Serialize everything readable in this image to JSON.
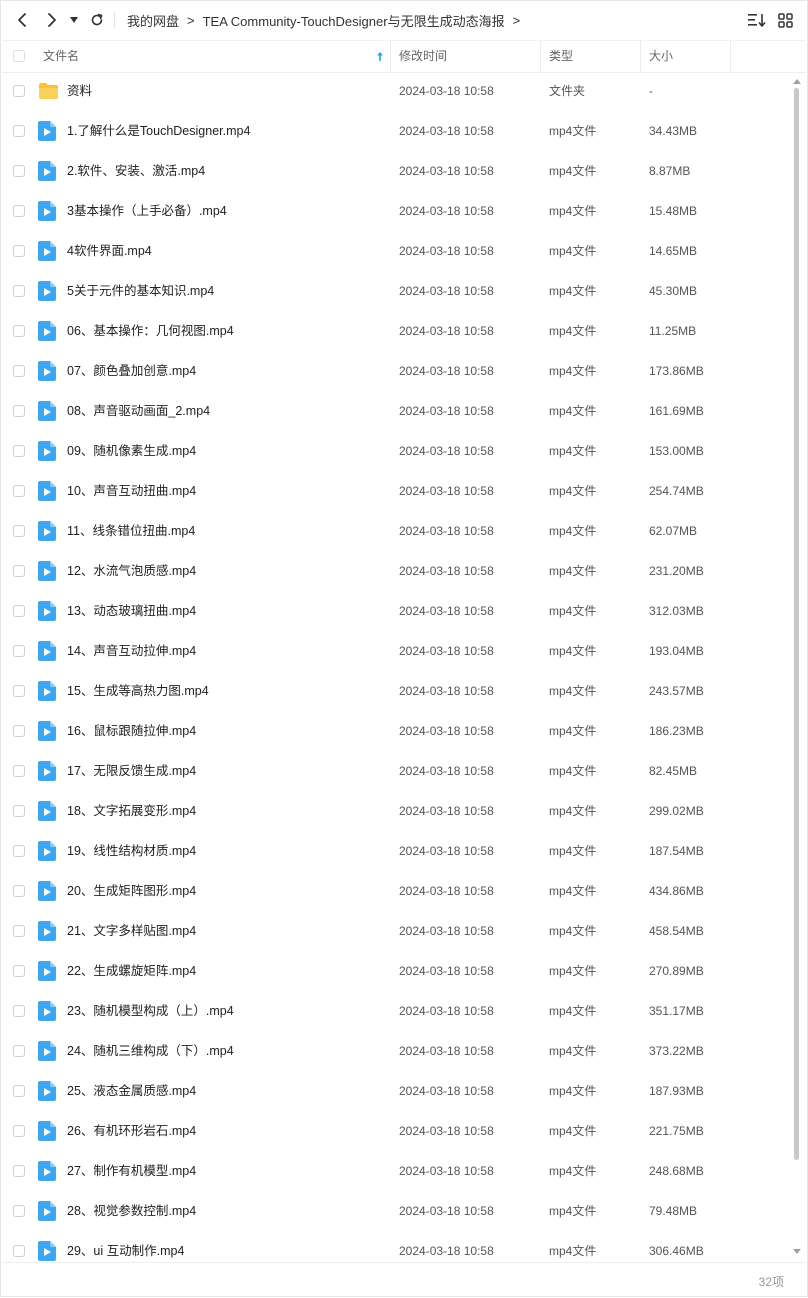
{
  "nav": {
    "breadcrumbs": [
      "我的网盘",
      "TEA Community-TouchDesigner与无限生成动态海报"
    ]
  },
  "columns": {
    "name": "文件名",
    "time": "修改时间",
    "type": "类型",
    "size": "大小"
  },
  "files": [
    {
      "name": "资料",
      "time": "2024-03-18 10:58",
      "type": "文件夹",
      "size": "-",
      "icon": "folder-icon"
    },
    {
      "name": "1.了解什么是TouchDesigner.mp4",
      "time": "2024-03-18 10:58",
      "type": "mp4文件",
      "size": "34.43MB",
      "icon": "video-file-icon"
    },
    {
      "name": "2.软件、安装、激活.mp4",
      "time": "2024-03-18 10:58",
      "type": "mp4文件",
      "size": "8.87MB",
      "icon": "video-file-icon"
    },
    {
      "name": "3基本操作（上手必备）.mp4",
      "time": "2024-03-18 10:58",
      "type": "mp4文件",
      "size": "15.48MB",
      "icon": "video-file-icon"
    },
    {
      "name": "4软件界面.mp4",
      "time": "2024-03-18 10:58",
      "type": "mp4文件",
      "size": "14.65MB",
      "icon": "video-file-icon"
    },
    {
      "name": "5关于元件的基本知识.mp4",
      "time": "2024-03-18 10:58",
      "type": "mp4文件",
      "size": "45.30MB",
      "icon": "video-file-icon"
    },
    {
      "name": "06、基本操作：几何视图.mp4",
      "time": "2024-03-18 10:58",
      "type": "mp4文件",
      "size": "11.25MB",
      "icon": "video-file-icon"
    },
    {
      "name": "07、颜色叠加创意.mp4",
      "time": "2024-03-18 10:58",
      "type": "mp4文件",
      "size": "173.86MB",
      "icon": "video-file-icon"
    },
    {
      "name": "08、声音驱动画面_2.mp4",
      "time": "2024-03-18 10:58",
      "type": "mp4文件",
      "size": "161.69MB",
      "icon": "video-file-icon"
    },
    {
      "name": "09、随机像素生成.mp4",
      "time": "2024-03-18 10:58",
      "type": "mp4文件",
      "size": "153.00MB",
      "icon": "video-file-icon"
    },
    {
      "name": "10、声音互动扭曲.mp4",
      "time": "2024-03-18 10:58",
      "type": "mp4文件",
      "size": "254.74MB",
      "icon": "video-file-icon"
    },
    {
      "name": "11、线条错位扭曲.mp4",
      "time": "2024-03-18 10:58",
      "type": "mp4文件",
      "size": "62.07MB",
      "icon": "video-file-icon"
    },
    {
      "name": "12、水流气泡质感.mp4",
      "time": "2024-03-18 10:58",
      "type": "mp4文件",
      "size": "231.20MB",
      "icon": "video-file-icon"
    },
    {
      "name": "13、动态玻璃扭曲.mp4",
      "time": "2024-03-18 10:58",
      "type": "mp4文件",
      "size": "312.03MB",
      "icon": "video-file-icon"
    },
    {
      "name": "14、声音互动拉伸.mp4",
      "time": "2024-03-18 10:58",
      "type": "mp4文件",
      "size": "193.04MB",
      "icon": "video-file-icon"
    },
    {
      "name": "15、生成等高热力图.mp4",
      "time": "2024-03-18 10:58",
      "type": "mp4文件",
      "size": "243.57MB",
      "icon": "video-file-icon"
    },
    {
      "name": "16、鼠标跟随拉伸.mp4",
      "time": "2024-03-18 10:58",
      "type": "mp4文件",
      "size": "186.23MB",
      "icon": "video-file-icon"
    },
    {
      "name": "17、无限反馈生成.mp4",
      "time": "2024-03-18 10:58",
      "type": "mp4文件",
      "size": "82.45MB",
      "icon": "video-file-icon"
    },
    {
      "name": "18、文字拓展变形.mp4",
      "time": "2024-03-18 10:58",
      "type": "mp4文件",
      "size": "299.02MB",
      "icon": "video-file-icon"
    },
    {
      "name": "19、线性结构材质.mp4",
      "time": "2024-03-18 10:58",
      "type": "mp4文件",
      "size": "187.54MB",
      "icon": "video-file-icon"
    },
    {
      "name": "20、生成矩阵图形.mp4",
      "time": "2024-03-18 10:58",
      "type": "mp4文件",
      "size": "434.86MB",
      "icon": "video-file-icon"
    },
    {
      "name": "21、文字多样贴图.mp4",
      "time": "2024-03-18 10:58",
      "type": "mp4文件",
      "size": "458.54MB",
      "icon": "video-file-icon"
    },
    {
      "name": "22、生成螺旋矩阵.mp4",
      "time": "2024-03-18 10:58",
      "type": "mp4文件",
      "size": "270.89MB",
      "icon": "video-file-icon"
    },
    {
      "name": "23、随机模型构成（上）.mp4",
      "time": "2024-03-18 10:58",
      "type": "mp4文件",
      "size": "351.17MB",
      "icon": "video-file-icon"
    },
    {
      "name": "24、随机三维构成（下）.mp4",
      "time": "2024-03-18 10:58",
      "type": "mp4文件",
      "size": "373.22MB",
      "icon": "video-file-icon"
    },
    {
      "name": "25、液态金属质感.mp4",
      "time": "2024-03-18 10:58",
      "type": "mp4文件",
      "size": "187.93MB",
      "icon": "video-file-icon"
    },
    {
      "name": "26、有机环形岩石.mp4",
      "time": "2024-03-18 10:58",
      "type": "mp4文件",
      "size": "221.75MB",
      "icon": "video-file-icon"
    },
    {
      "name": "27、制作有机模型.mp4",
      "time": "2024-03-18 10:58",
      "type": "mp4文件",
      "size": "248.68MB",
      "icon": "video-file-icon"
    },
    {
      "name": "28、视觉参数控制.mp4",
      "time": "2024-03-18 10:58",
      "type": "mp4文件",
      "size": "79.48MB",
      "icon": "video-file-icon"
    },
    {
      "name": "29、ui 互动制作.mp4",
      "time": "2024-03-18 10:58",
      "type": "mp4文件",
      "size": "306.46MB",
      "icon": "video-file-icon"
    }
  ],
  "footer": {
    "count": "32项"
  },
  "colors": {
    "folder": "#f8c33a",
    "video": "#3da6f2",
    "sort_arrow": "#1aa3e8"
  }
}
